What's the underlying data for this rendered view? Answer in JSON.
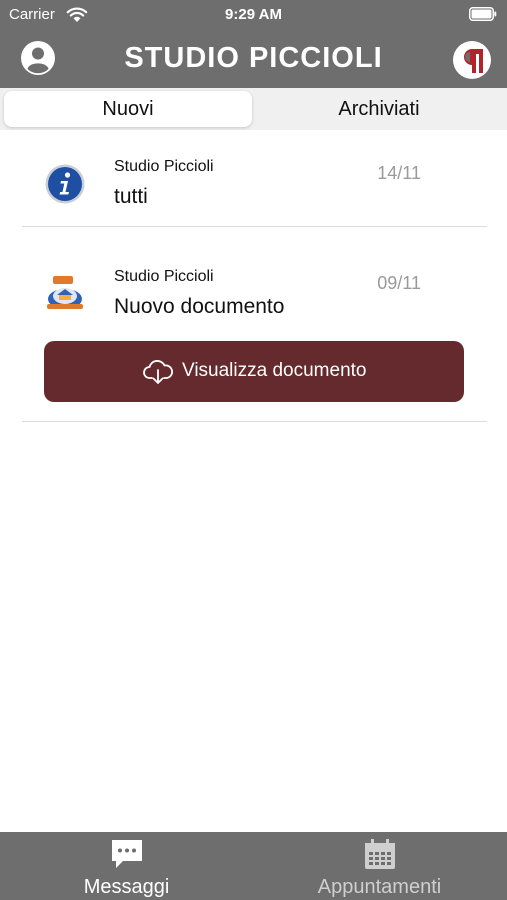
{
  "status_bar": {
    "carrier": "Carrier",
    "time": "9:29 AM"
  },
  "header": {
    "title": "STUDIO PICCIOLI",
    "left_icon": "user-circle-icon",
    "right_icon": "studio-logo-icon"
  },
  "tabs": [
    {
      "label": "Nuovi",
      "active": true
    },
    {
      "label": "Archiviati",
      "active": false
    }
  ],
  "messages": [
    {
      "sender": "Studio Piccioli",
      "subject": "tutti",
      "date": "14/11",
      "icon": "info-icon"
    },
    {
      "sender": "Studio Piccioli",
      "subject": "Nuovo documento",
      "date": "09/11",
      "icon": "document-badge-icon",
      "action": {
        "label": "Visualizza documento",
        "icon": "cloud-download-icon"
      }
    }
  ],
  "tabbar": [
    {
      "label": "Messaggi",
      "icon": "chat-bubble-icon",
      "active": true
    },
    {
      "label": "Appuntamenti",
      "icon": "calendar-icon",
      "active": false
    }
  ],
  "colors": {
    "header_bg": "#6e6e6e",
    "action_button_bg": "#652a2d",
    "date_text": "#9a9a9a"
  }
}
